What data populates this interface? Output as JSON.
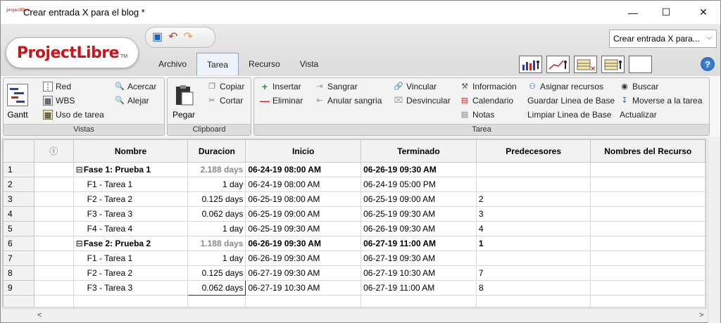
{
  "window": {
    "title": "Crear entrada X para el blog *",
    "app_icon_text": "projectlibre",
    "minimize_label": "—",
    "maximize_label": "☐",
    "close_label": "✕"
  },
  "logo": {
    "text": "ProjectLibre",
    "tm": "TM"
  },
  "project_selector": {
    "value": "Crear entrada X para...",
    "arrow": "⌵"
  },
  "tabs": [
    {
      "label": "Archivo"
    },
    {
      "label": "Tarea"
    },
    {
      "label": "Recurso"
    },
    {
      "label": "Vista"
    }
  ],
  "active_tab": "Tarea",
  "ribbon": {
    "vistas": {
      "label": "Vistas",
      "gantt": "Gantt",
      "red": "Red",
      "wbs": "WBS",
      "uso_tarea": "Uso de tarea",
      "acercar": "Acercar",
      "alejar": "Alejar"
    },
    "clipboard": {
      "label": "Clipboard",
      "pegar": "Pegar",
      "copiar": "Copiar",
      "cortar": "Cortar"
    },
    "tarea": {
      "label": "Tarea",
      "insertar": "Insertar",
      "eliminar": "Eliminar",
      "sangrar": "Sangrar",
      "anular_sangria": "Anular sangria",
      "vincular": "Vincular",
      "desvincular": "Desvincular",
      "informacion": "Información",
      "calendario": "Calendario",
      "notas": "Notas",
      "asignar_recursos": "Asignar recursos",
      "guardar_linea_base": "Guardar Linea de Base",
      "limpiar_linea_base": "Limpiar Linea de Base",
      "buscar": "Buscar",
      "moverse_tarea": "Moverse a la tarea",
      "actualizar": "Actualizar"
    }
  },
  "table": {
    "columns": [
      "",
      "ⓘ",
      "Nombre",
      "Duracion",
      "Inicio",
      "Terminado",
      "Predecesores",
      "Nombres del Recurso"
    ],
    "rows": [
      {
        "id": "1",
        "name": "Fase 1: Prueba 1",
        "duration": "2.188 days",
        "start": "06-24-19 08:00 AM",
        "finish": "06-26-19 09:30 AM",
        "pred": "",
        "summary": true
      },
      {
        "id": "2",
        "name": "F1 - Tarea 1",
        "duration": "1 day",
        "start": "06-24-19 08:00 AM",
        "finish": "06-24-19 05:00 PM",
        "pred": "",
        "summary": false
      },
      {
        "id": "3",
        "name": "F2 - Tarea 2",
        "duration": "0.125 days",
        "start": "06-25-19 08:00 AM",
        "finish": "06-25-19 09:00 AM",
        "pred": "2",
        "summary": false
      },
      {
        "id": "4",
        "name": "F3 - Tarea 3",
        "duration": "0.062 days",
        "start": "06-25-19 09:00 AM",
        "finish": "06-25-19 09:30 AM",
        "pred": "3",
        "summary": false
      },
      {
        "id": "5",
        "name": "F4 - Tarea 4",
        "duration": "1 day",
        "start": "06-25-19 09:30 AM",
        "finish": "06-26-19 09:30 AM",
        "pred": "4",
        "summary": false
      },
      {
        "id": "6",
        "name": "Fase 2: Prueba 2",
        "duration": "1.188 days",
        "start": "06-26-19 09:30 AM",
        "finish": "06-27-19 11:00 AM",
        "pred": "1",
        "summary": true
      },
      {
        "id": "7",
        "name": "F1 - Tarea 1",
        "duration": "1 day",
        "start": "06-26-19 09:30 AM",
        "finish": "06-27-19 09:30 AM",
        "pred": "",
        "summary": false
      },
      {
        "id": "8",
        "name": "F2 - Tarea 2",
        "duration": "0.125 days",
        "start": "06-27-19 09:30 AM",
        "finish": "06-27-19 10:30 AM",
        "pred": "7",
        "summary": false
      },
      {
        "id": "9",
        "name": "F3 - Tarea 3",
        "duration": "0.062 days",
        "start": "06-27-19 10:30 AM",
        "finish": "06-27-19 11:00 AM",
        "pred": "8",
        "summary": false,
        "selected_duration": true
      }
    ]
  },
  "scroll": {
    "left_arrow": "<",
    "right_arrow": ">"
  }
}
